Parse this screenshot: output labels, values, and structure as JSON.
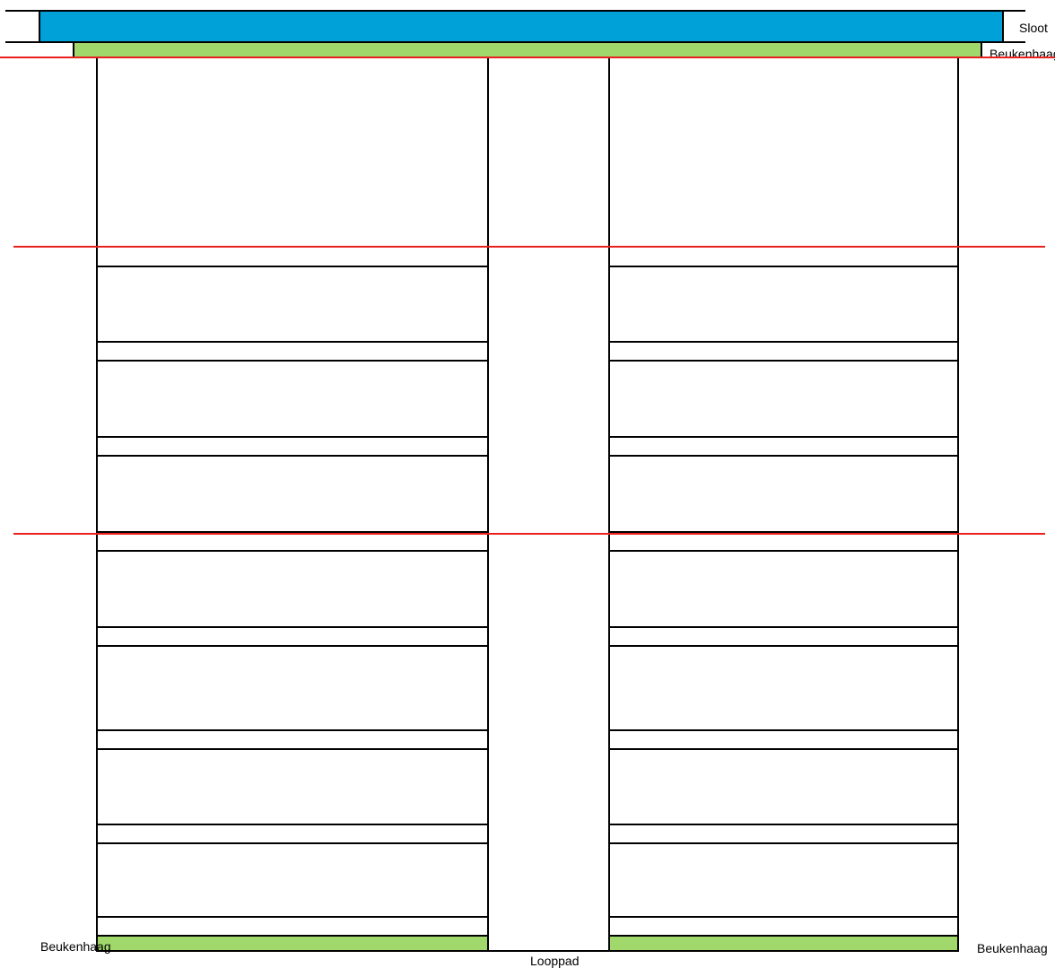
{
  "labels": {
    "ditch": "Sloot",
    "hedge_top": "Beukenhaag",
    "hedge_bottom_left": "Beukenhaag",
    "hedge_bottom_right": "Beukenhaag",
    "path": "Looppad"
  },
  "colors": {
    "ditch": "#00A0D8",
    "hedge": "#A0D86C",
    "outline": "#000000",
    "marker_line": "#E8211F",
    "background": "#FFFFFF"
  }
}
